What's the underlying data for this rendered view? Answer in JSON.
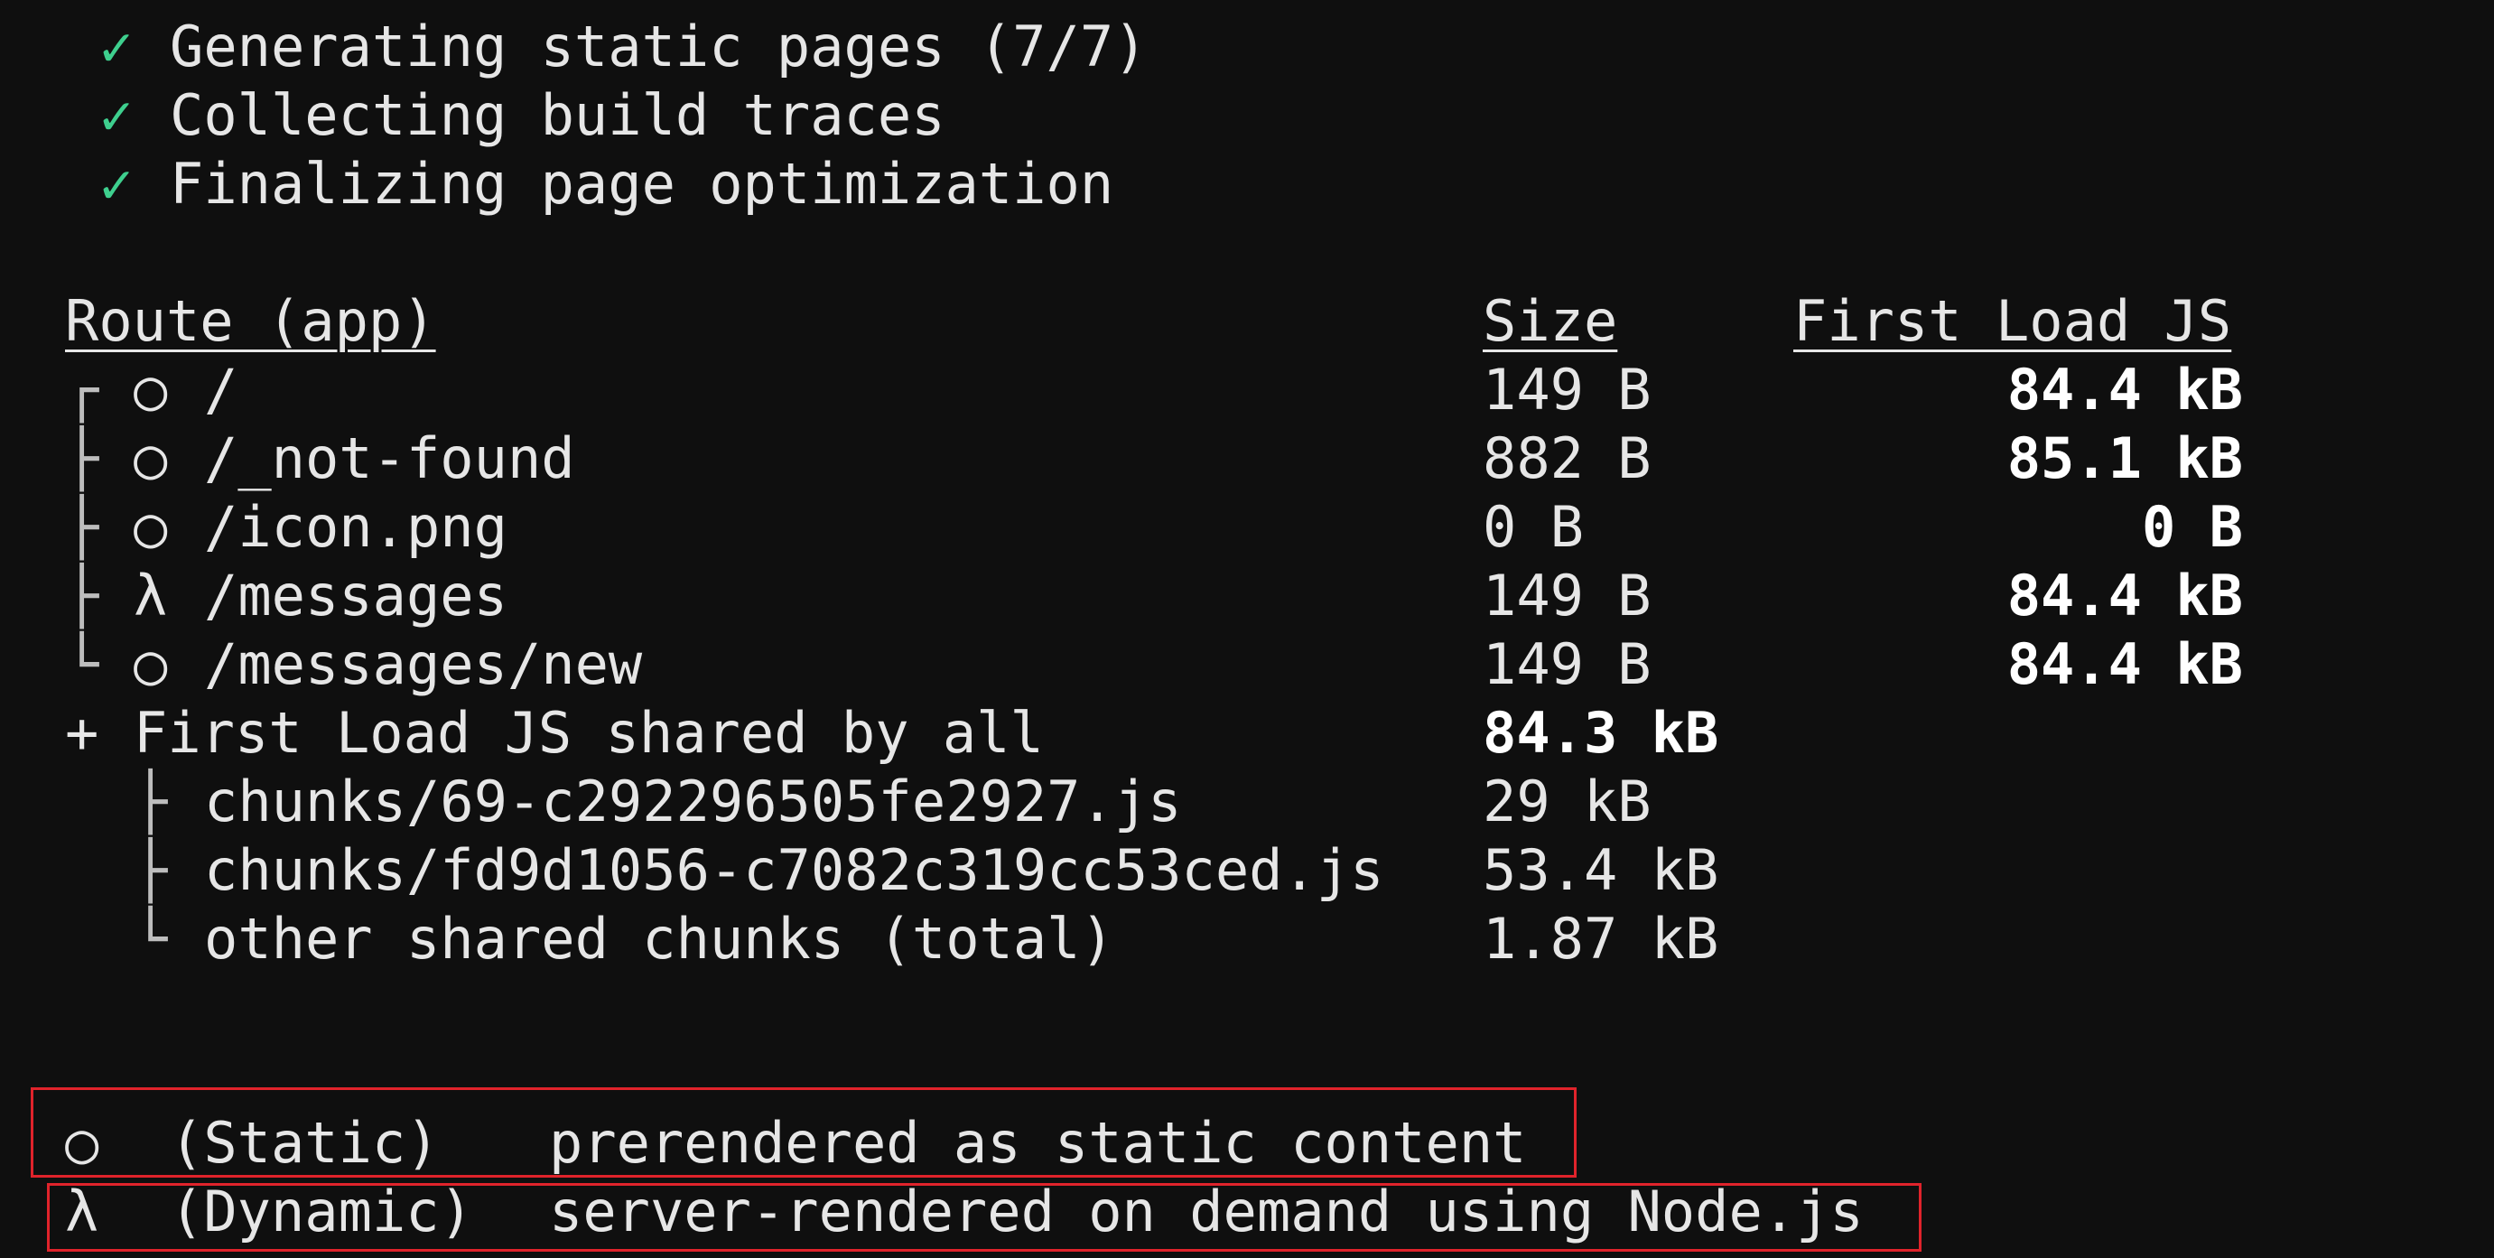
{
  "progress": [
    {
      "icon": "✓",
      "text": "Generating static pages (7/7)"
    },
    {
      "icon": "✓",
      "text": "Collecting build traces"
    },
    {
      "icon": "✓",
      "text": "Finalizing page optimization"
    }
  ],
  "table": {
    "headers": {
      "route": "Route (app)",
      "size": "Size",
      "first_load": "First Load JS"
    },
    "rows": [
      {
        "tree": "┌",
        "symbol": "○",
        "route": "/",
        "size": "149 B",
        "first_load": "84.4 kB"
      },
      {
        "tree": "├",
        "symbol": "○",
        "route": "/_not-found",
        "size": "882 B",
        "first_load": "85.1 kB"
      },
      {
        "tree": "├",
        "symbol": "○",
        "route": "/icon.png",
        "size": "0 B",
        "first_load": "0 B"
      },
      {
        "tree": "├",
        "symbol": "λ",
        "route": "/messages",
        "size": "149 B",
        "first_load": "84.4 kB"
      },
      {
        "tree": "└",
        "symbol": "○",
        "route": "/messages/new",
        "size": "149 B",
        "first_load": "84.4 kB"
      }
    ],
    "shared": {
      "prefix": "+",
      "label": "First Load JS shared by all",
      "total": "84.3 kB",
      "chunks": [
        {
          "tree": "├",
          "name": "chunks/69-c292296505fe2927.js",
          "size": "29 kB"
        },
        {
          "tree": "├",
          "name": "chunks/fd9d1056-c7082c319cc53ced.js",
          "size": "53.4 kB"
        },
        {
          "tree": "└",
          "name": "other shared chunks (total)",
          "size": "1.87 kB"
        }
      ]
    }
  },
  "legend": [
    {
      "symbol": "○",
      "type": "(Static)",
      "description": "prerendered as static content"
    },
    {
      "symbol": "λ",
      "type": "(Dynamic)",
      "description": "server-rendered on demand using Node.js"
    }
  ],
  "colors": {
    "background": "#0f0f0f",
    "check": "#3ecf8e",
    "highlight_box": "#e0232b"
  }
}
